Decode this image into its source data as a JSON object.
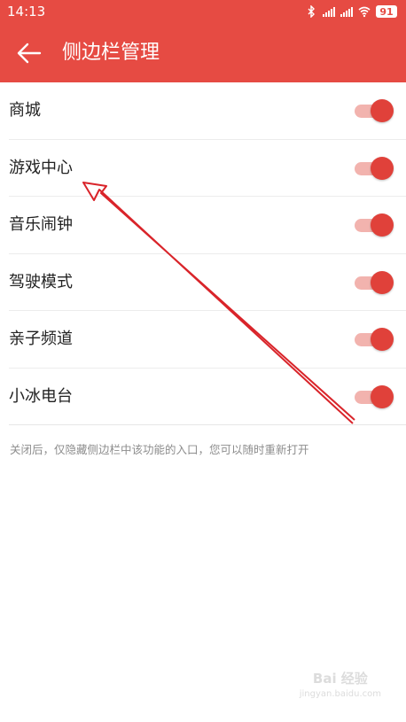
{
  "status_bar": {
    "time": "14:13",
    "battery": "91",
    "icons": [
      "bluetooth-icon",
      "signal-icon",
      "signal-icon",
      "wifi-icon",
      "battery-icon"
    ]
  },
  "header": {
    "title": "侧边栏管理",
    "back_icon": "back-arrow-icon"
  },
  "items": [
    {
      "label": "商城",
      "enabled": true
    },
    {
      "label": "游戏中心",
      "enabled": true
    },
    {
      "label": "音乐闹钟",
      "enabled": true
    },
    {
      "label": "驾驶模式",
      "enabled": true
    },
    {
      "label": "亲子频道",
      "enabled": true
    },
    {
      "label": "小冰电台",
      "enabled": true
    }
  ],
  "footer_note": "关闭后，仅隐藏侧边栏中该功能的入口，您可以随时重新打开",
  "watermark": {
    "brand": "Bai 经验",
    "url": "jingyan.baidu.com"
  },
  "colors": {
    "accent": "#e64b43",
    "toggle_thumb": "#e0413a",
    "toggle_track": "#f2b3ae",
    "annotation_arrow": "#d9242a"
  }
}
